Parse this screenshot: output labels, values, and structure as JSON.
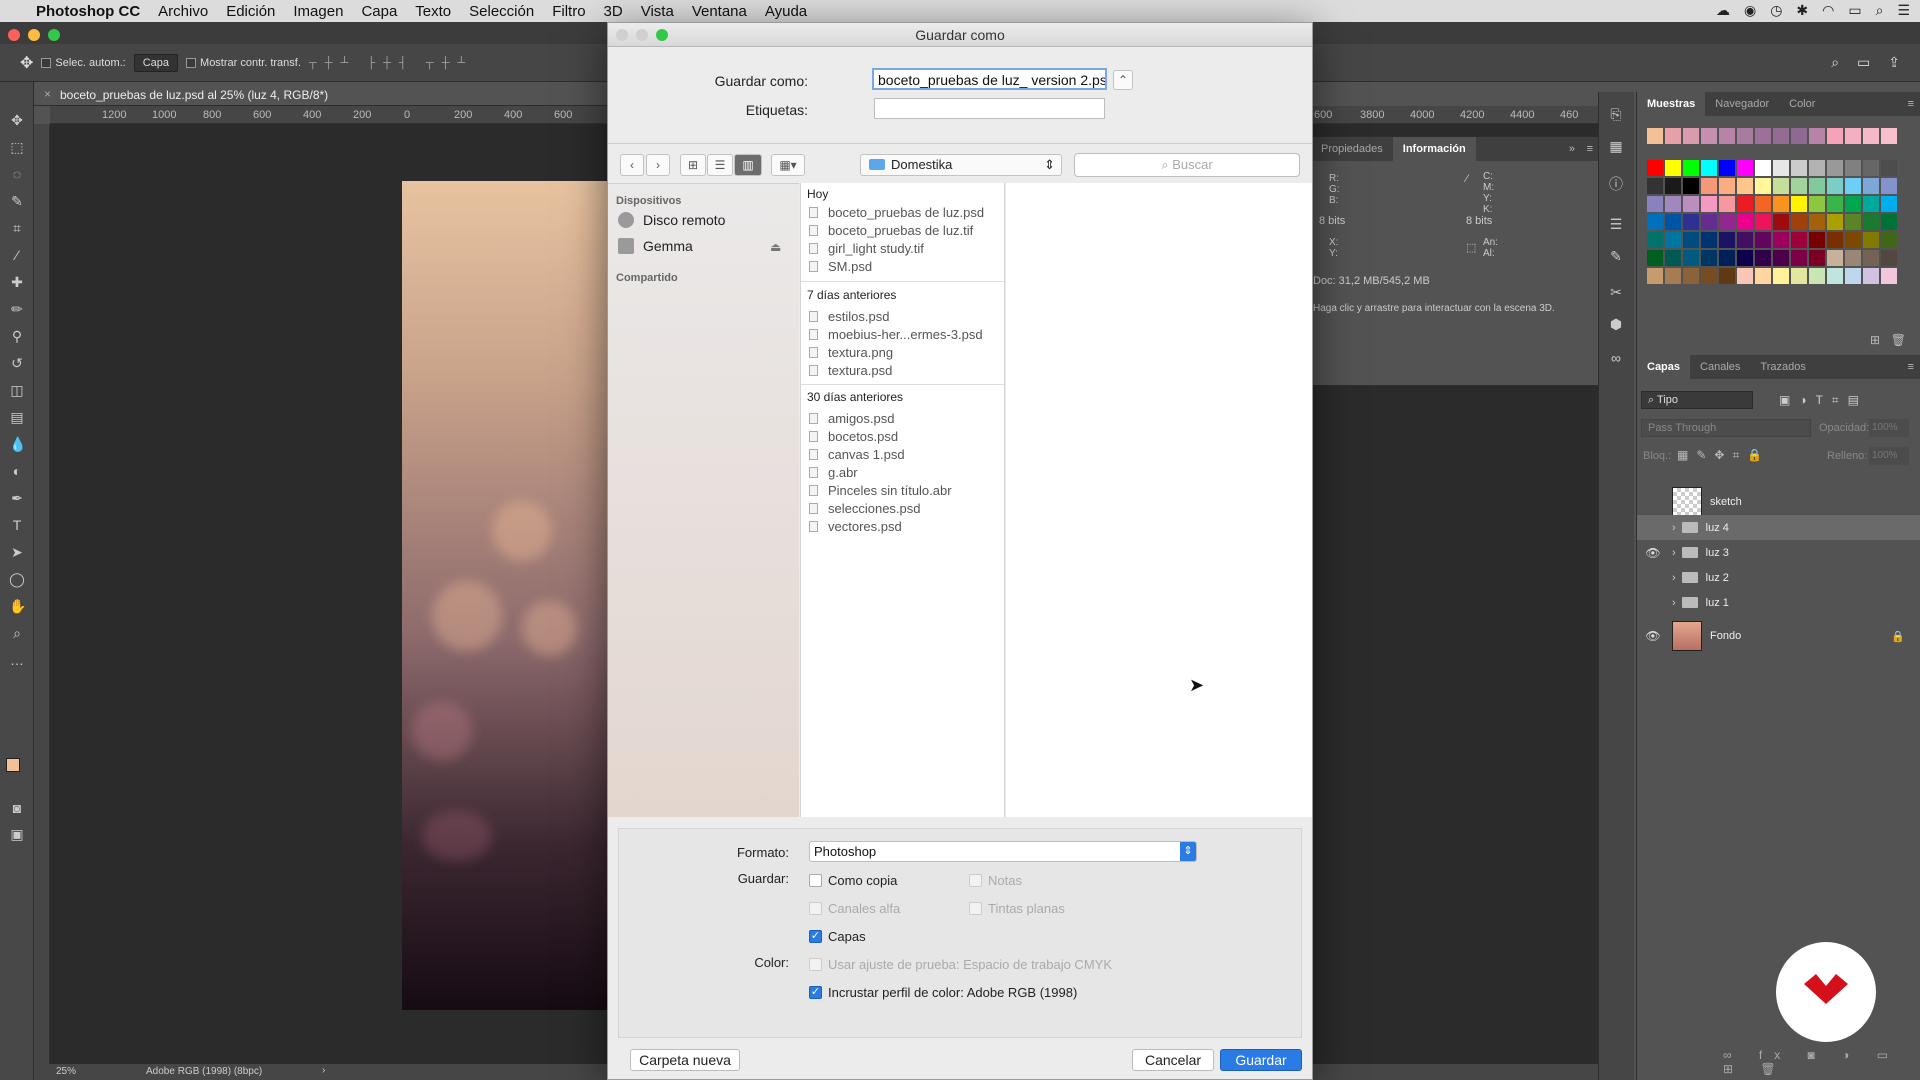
{
  "menubar": {
    "app": "Photoshop CC",
    "items": [
      "Archivo",
      "Edición",
      "Imagen",
      "Capa",
      "Texto",
      "Selección",
      "Filtro",
      "3D",
      "Vista",
      "Ventana",
      "Ayuda"
    ]
  },
  "options": {
    "auto_select": "Selec. autom.:",
    "target": "Capa",
    "show_transform": "Mostrar contr. transf."
  },
  "document": {
    "tab_title": "boceto_pruebas de luz.psd al 25% (luz 4, RGB/8*)",
    "ruler_ticks": [
      "1200",
      "1000",
      "800",
      "600",
      "400",
      "200",
      "0",
      "200",
      "400",
      "600"
    ],
    "ruler_ticks_right": [
      "600",
      "3800",
      "4000",
      "4200",
      "4400",
      "460"
    ],
    "zoom": "25%",
    "profile": "Adobe RGB (1998) (8bpc)"
  },
  "swatches_panel": {
    "tabs": [
      "Muestras",
      "Navegador",
      "Color"
    ]
  },
  "info_panel": {
    "tabs": [
      "Propiedades",
      "Información"
    ],
    "rgb_labels": "R:\nG:\nB:",
    "cmyk_labels": "C:\nM:\nY:\nK:",
    "bits_left": "8 bits",
    "bits_right": "8 bits",
    "xy_labels": "X:\nY:",
    "size_labels": "An:\nAl:",
    "doc": "Doc: 31,2 MB/545,2 MB",
    "hint": "Haga clic y arrastre para interactuar con la escena 3D."
  },
  "layers_panel": {
    "tabs": [
      "Capas",
      "Canales",
      "Trazados"
    ],
    "filter": "Tipo",
    "blend": "Pass Through",
    "opacity_label": "Opacidad:",
    "opacity": "100%",
    "lock_label": "Bloq.:",
    "fill_label": "Relleno:",
    "fill": "100%",
    "layers": [
      {
        "name": "sketch",
        "visible": false
      },
      {
        "name": "luz 4",
        "visible": false
      },
      {
        "name": "luz 3",
        "visible": true
      },
      {
        "name": "luz 2",
        "visible": false
      },
      {
        "name": "luz 1",
        "visible": false
      },
      {
        "name": "Fondo",
        "visible": true
      }
    ]
  },
  "dialog": {
    "title": "Guardar como",
    "save_as_label": "Guardar como:",
    "save_as_value": "boceto_pruebas de luz_ version 2.psd",
    "tags_label": "Etiquetas:",
    "tags_value": "",
    "location": "Domestika",
    "search_placeholder": "Buscar",
    "sidebar": {
      "devices_header": "Dispositivos",
      "devices": [
        "Disco remoto",
        "Gemma"
      ],
      "shared_header": "Compartido"
    },
    "groups": [
      {
        "header": "Hoy",
        "files": [
          "boceto_pruebas de luz.psd",
          "boceto_pruebas de luz.tif",
          "girl_light study.tif",
          "SM.psd"
        ]
      },
      {
        "header": "7 días anteriores",
        "files": [
          "estilos.psd",
          "moebius-her...ermes-3.psd",
          "textura.png",
          "textura.psd"
        ]
      },
      {
        "header": "30 días anteriores",
        "files": [
          "amigos.psd",
          "bocetos.psd",
          "canvas 1.psd",
          "g.abr",
          "Pinceles sin título.abr",
          "selecciones.psd",
          "vectores.psd"
        ]
      }
    ],
    "format_label": "Formato:",
    "format_value": "Photoshop",
    "save_label": "Guardar:",
    "color_label": "Color:",
    "opt_copy": "Como copia",
    "opt_notes": "Notas",
    "opt_alpha": "Canales alfa",
    "opt_spot": "Tintas planas",
    "opt_layers": "Capas",
    "opt_proof": "Usar ajuste de prueba: Espacio de trabajo CMYK",
    "opt_embed": "Incrustar perfil de color: Adobe RGB (1998)",
    "new_folder": "Carpeta nueva",
    "cancel": "Cancelar",
    "save": "Guardar"
  }
}
